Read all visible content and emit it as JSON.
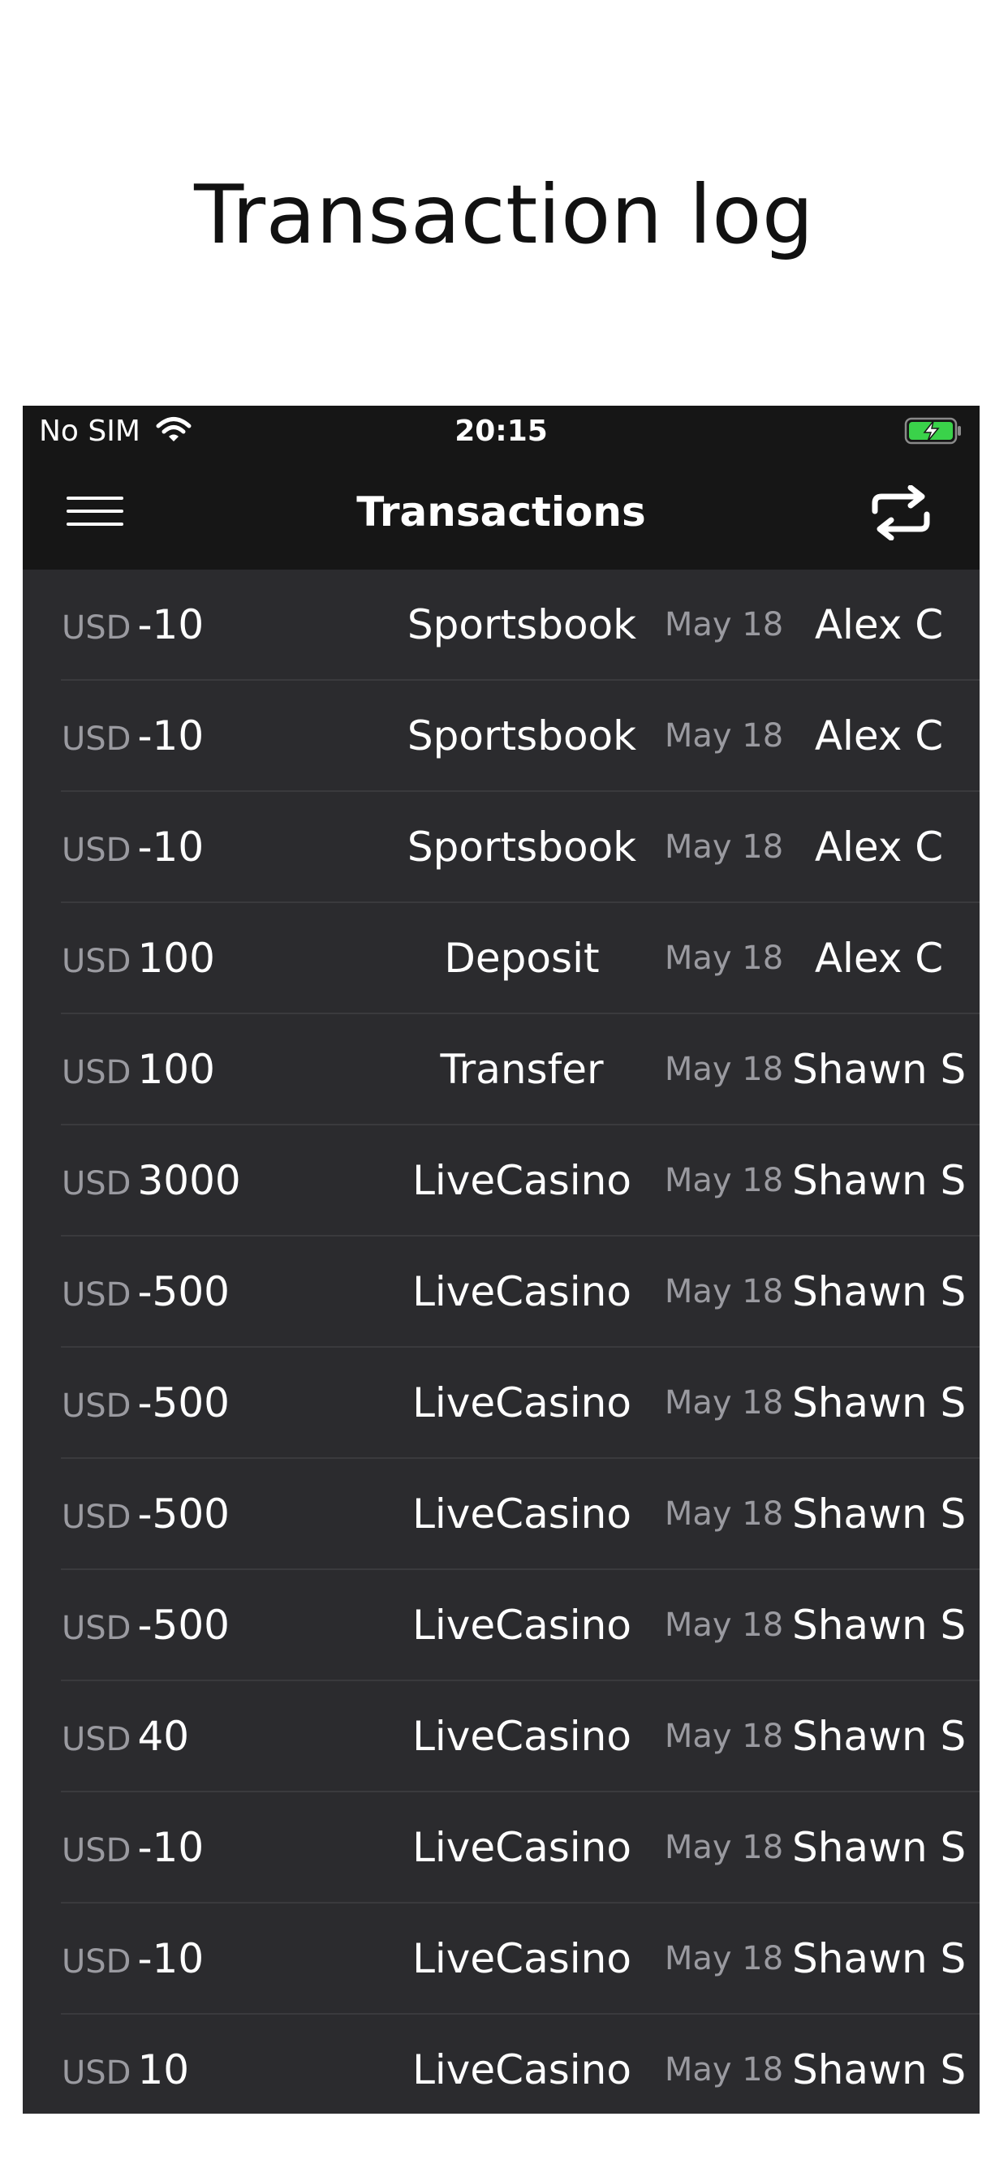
{
  "caption": "Transaction log",
  "status_bar": {
    "carrier": "No SIM",
    "time": "20:15",
    "wifi_icon": "wifi-icon",
    "battery_icon": "battery-charging-icon"
  },
  "nav": {
    "title": "Transactions",
    "menu_icon": "hamburger-menu-icon",
    "action_icon": "transfer-arrows-icon"
  },
  "colors": {
    "header_bg": "#161616",
    "list_bg": "#2b2b2e",
    "separator": "#3a3a3d",
    "secondary_text": "#9a9aa0",
    "battery_green": "#3ad24a"
  },
  "transactions": [
    {
      "currency": "USD",
      "amount": "-10",
      "category": "Sportsbook",
      "date": "May 18",
      "user": "Alex C"
    },
    {
      "currency": "USD",
      "amount": "-10",
      "category": "Sportsbook",
      "date": "May 18",
      "user": "Alex C"
    },
    {
      "currency": "USD",
      "amount": "-10",
      "category": "Sportsbook",
      "date": "May 18",
      "user": "Alex C"
    },
    {
      "currency": "USD",
      "amount": "100",
      "category": "Deposit",
      "date": "May 18",
      "user": "Alex C"
    },
    {
      "currency": "USD",
      "amount": "100",
      "category": "Transfer",
      "date": "May 18",
      "user": "Shawn S"
    },
    {
      "currency": "USD",
      "amount": "3000",
      "category": "LiveCasino",
      "date": "May 18",
      "user": "Shawn S"
    },
    {
      "currency": "USD",
      "amount": "-500",
      "category": "LiveCasino",
      "date": "May 18",
      "user": "Shawn S"
    },
    {
      "currency": "USD",
      "amount": "-500",
      "category": "LiveCasino",
      "date": "May 18",
      "user": "Shawn S"
    },
    {
      "currency": "USD",
      "amount": "-500",
      "category": "LiveCasino",
      "date": "May 18",
      "user": "Shawn S"
    },
    {
      "currency": "USD",
      "amount": "-500",
      "category": "LiveCasino",
      "date": "May 18",
      "user": "Shawn S"
    },
    {
      "currency": "USD",
      "amount": "40",
      "category": "LiveCasino",
      "date": "May 18",
      "user": "Shawn S"
    },
    {
      "currency": "USD",
      "amount": "-10",
      "category": "LiveCasino",
      "date": "May 18",
      "user": "Shawn S"
    },
    {
      "currency": "USD",
      "amount": "-10",
      "category": "LiveCasino",
      "date": "May 18",
      "user": "Shawn S"
    },
    {
      "currency": "USD",
      "amount": "10",
      "category": "LiveCasino",
      "date": "May 18",
      "user": "Shawn S"
    }
  ]
}
